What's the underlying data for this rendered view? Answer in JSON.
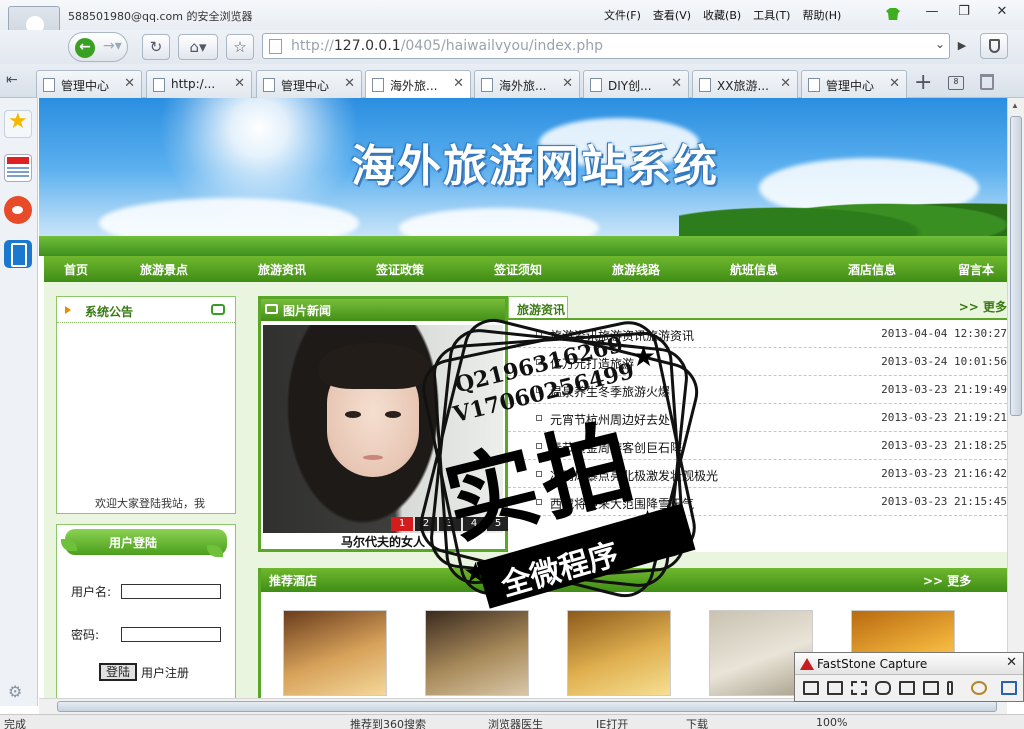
{
  "browser": {
    "account": "588501980@qq.com 的安全浏览器",
    "menus": [
      "文件(F)",
      "查看(V)",
      "收藏(B)",
      "工具(T)",
      "帮助(H)"
    ],
    "window_controls": [
      "—",
      "❐",
      "✕"
    ],
    "url_prefix": "http://",
    "url_host": "127.0.0.1",
    "url_path": "/0405/haiwailvyou/index.php",
    "tabs": [
      {
        "label": "管理中心",
        "active": false
      },
      {
        "label": "http:/...",
        "active": false
      },
      {
        "label": "管理中心",
        "active": false
      },
      {
        "label": "海外旅...",
        "active": true
      },
      {
        "label": "海外旅...",
        "active": false
      },
      {
        "label": "DIY创...",
        "active": false
      },
      {
        "label": "XX旅游...",
        "active": false
      },
      {
        "label": "管理中心",
        "active": false
      }
    ],
    "tab_restore_count": "8",
    "status": {
      "left": "完成",
      "items": [
        "推荐到360搜索",
        "浏览器医生",
        "IE打开",
        "下载",
        "100%"
      ]
    }
  },
  "site": {
    "title": "海外旅游网站系统",
    "nav": [
      "首页",
      "旅游景点",
      "旅游资讯",
      "签证政策",
      "签证须知",
      "旅游线路",
      "航班信息",
      "酒店信息",
      "留言本"
    ],
    "notice": {
      "title": "系统公告",
      "scroll_text": "欢迎大家登陆我站，我"
    },
    "login": {
      "title": "用户登陆",
      "username_label": "用户名:",
      "password_label": "密码:",
      "login_button": "登陆",
      "register_link": "用户注册"
    },
    "photo_news": {
      "title": "图片新闻",
      "caption": "马尔代夫的女人",
      "pages": [
        "1",
        "2",
        "3",
        "4",
        "5"
      ],
      "active_page": "1"
    },
    "travel_news": {
      "title": "旅游资讯",
      "more": ">> 更多",
      "items": [
        {
          "title": "旅游资讯旅游资讯旅游资讯",
          "date": "2013-04-04 12:30:27"
        },
        {
          "title": "亿万元打造旅游",
          "date": "2013-03-24 10:01:56"
        },
        {
          "title": "温泉养生冬季旅游火爆",
          "date": "2013-03-23 21:19:49"
        },
        {
          "title": "元宵节杭州周边好去处",
          "date": "2013-03-23 21:19:21"
        },
        {
          "title": "春节黄金周游客创巨石阵",
          "date": "2013-03-23 21:18:25"
        },
        {
          "title": "冰雨风暴点亮北极激发壮观极光",
          "date": "2013-03-23 21:16:42"
        },
        {
          "title": "西藏将迎来大范围降雪天气",
          "date": "2013-03-23 21:15:45"
        }
      ]
    },
    "hotels": {
      "title": "推荐酒店",
      "more": ">> 更多",
      "count": 5,
      "palettes": [
        [
          "#6a3c1c",
          "#d7a25a",
          "#f4d79a"
        ],
        [
          "#3b2a1e",
          "#a88a5a",
          "#d8c7a8"
        ],
        [
          "#8c5a1a",
          "#e0b050",
          "#f6df92"
        ],
        [
          "#c9c2b2",
          "#e9e4d8",
          "#a89f8a"
        ],
        [
          "#b96a10",
          "#f0b23a",
          "#fbe09a"
        ]
      ]
    }
  },
  "watermark": {
    "line1": "Q2196316269",
    "line2": "V17060256499",
    "big": "实拍",
    "ribbon": "全微程序"
  },
  "faststone": {
    "title": "FastStone Capture",
    "close": "✕"
  },
  "colors": {
    "nav_green": "#3f8d16",
    "panel_bg": "#eaf5df",
    "accent_text": "#3a7b14"
  }
}
